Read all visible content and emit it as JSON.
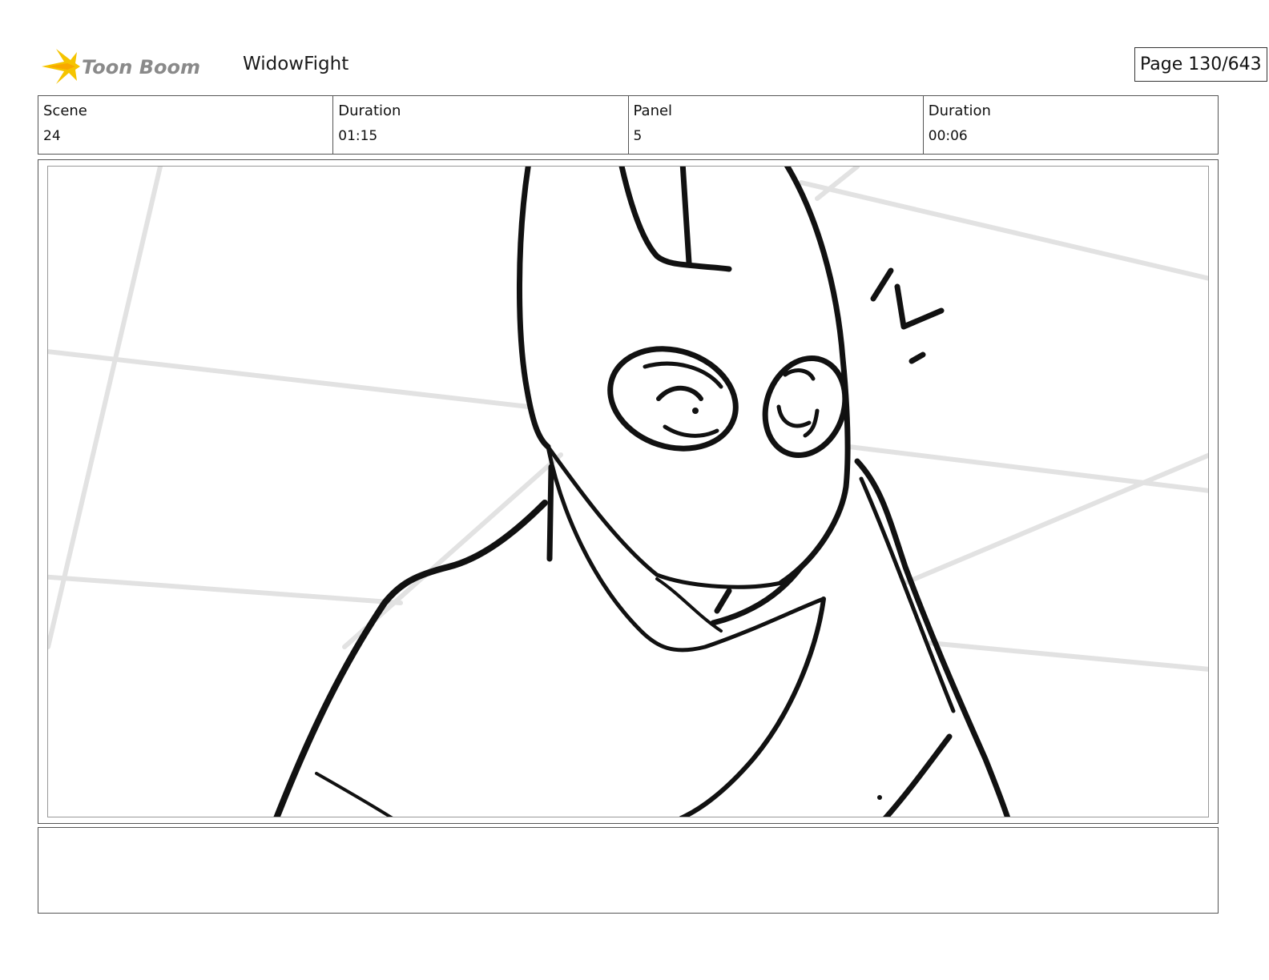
{
  "header": {
    "brand": "Toon Boom",
    "project_title": "WidowFight",
    "page_indicator": "Page 130/643"
  },
  "info": [
    {
      "label": "Scene",
      "value": "24"
    },
    {
      "label": "Duration",
      "value": "01:15"
    },
    {
      "label": "Panel",
      "value": "5"
    },
    {
      "label": "Duration",
      "value": "00:06"
    }
  ],
  "panel": {
    "description_notes": ""
  },
  "colors": {
    "logo_star": "#f5c400",
    "logo_text": "#8a8a8a",
    "ink": "#111111",
    "guide_lines": "#e2e2e2"
  }
}
